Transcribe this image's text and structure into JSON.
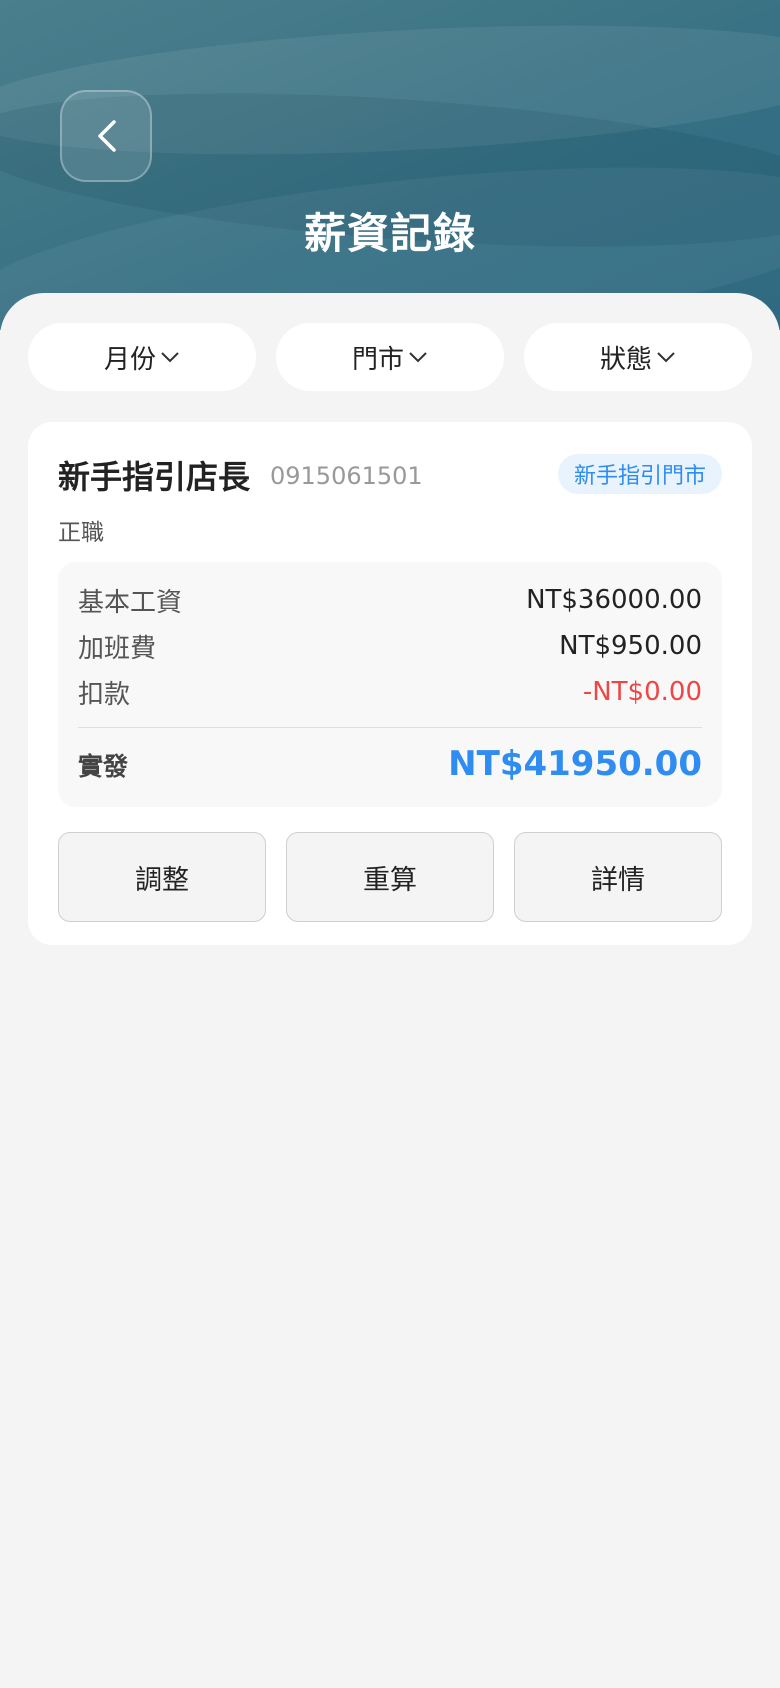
{
  "header": {
    "title": "薪資記錄",
    "back_icon": "chevron-left-icon"
  },
  "filters": {
    "month": "月份",
    "store": "門市",
    "status": "狀態",
    "dropdown_icon": "chevron-down-icon"
  },
  "record": {
    "name": "新手指引店長",
    "phone": "0915061501",
    "store_tag": "新手指引門市",
    "employment_type": "正職",
    "items": [
      {
        "label": "基本工資",
        "value": "NT$36000.00"
      },
      {
        "label": "加班費",
        "value": "NT$950.00"
      },
      {
        "label": "扣款",
        "value": "-NT$0.00"
      }
    ],
    "total_label": "實發",
    "total_value": "NT$41950.00",
    "actions": {
      "adjust": "調整",
      "recalculate": "重算",
      "details": "詳情"
    }
  },
  "colors": {
    "accent": "#2f8cf0",
    "negative": "#f04545",
    "header_bg": "#3f7686"
  }
}
